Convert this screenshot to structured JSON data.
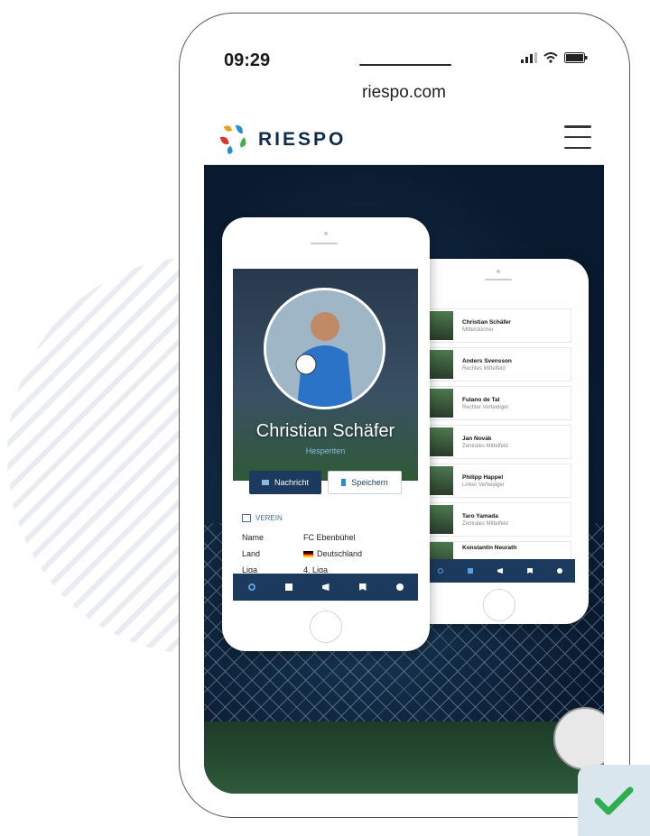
{
  "status": {
    "time": "09:29"
  },
  "browser": {
    "url": "riespo.com"
  },
  "nav": {
    "brand": "RIESPO"
  },
  "profile": {
    "name": "Christian Schäfer",
    "position": "Hesperiten",
    "message_btn": "Nachricht",
    "save_btn": "Speichern",
    "section": "VEREIN",
    "rows": [
      {
        "label": "Name",
        "value": "FC Ebenbühel"
      },
      {
        "label": "Land",
        "value": "Deutschland"
      },
      {
        "label": "Liga",
        "value": "4. Liga"
      }
    ]
  },
  "players": [
    {
      "name": "Christian Schäfer",
      "role": "Mittelstürmer"
    },
    {
      "name": "Anders Svensson",
      "role": "Rechtes Mittelfeld"
    },
    {
      "name": "Fulano de Tal",
      "role": "Rechter Verteidiger"
    },
    {
      "name": "Jan Novák",
      "role": "Zentrales Mittelfeld"
    },
    {
      "name": "Philipp Happel",
      "role": "Linker Verteidiger"
    },
    {
      "name": "Taro Yamada",
      "role": "Zentrales Mittelfeld"
    },
    {
      "name": "Konstantin Neurath",
      "role": ""
    }
  ],
  "colors": {
    "navy": "#1b3a5e",
    "accent_green": "#2fae4f",
    "brand": "#0f2c4f"
  }
}
